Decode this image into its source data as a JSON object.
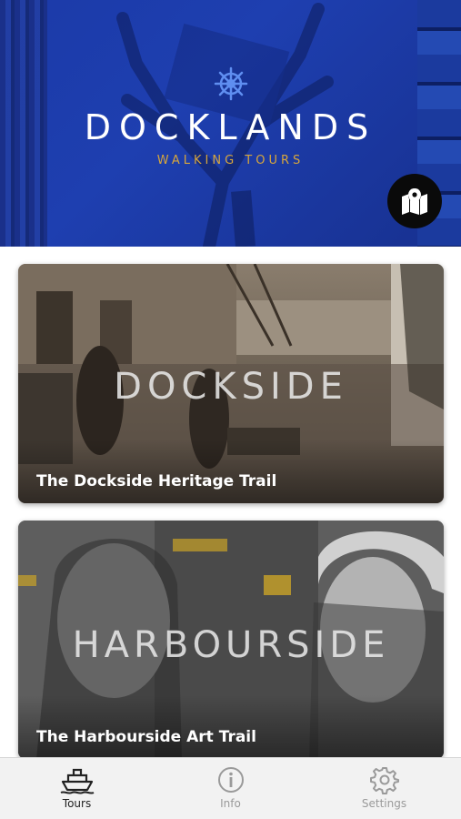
{
  "header": {
    "title": "DOCKLANDS",
    "subtitle": "WALKING TOURS",
    "wheel_icon": "ship-wheel-icon",
    "map_button_icon": "map-pin-icon",
    "colors": {
      "background": "#1e3fb0",
      "subtitle": "#d7a63c",
      "map_button": "#0a0a0a"
    }
  },
  "tours": [
    {
      "overlay_title": "DOCKSIDE",
      "name": "The Dockside Heritage Trail"
    },
    {
      "overlay_title": "HARBOURSIDE",
      "name": "The Harbourside Art Trail"
    }
  ],
  "tabbar": {
    "active": "Tours",
    "tabs": [
      {
        "label": "Tours",
        "icon": "ship-icon"
      },
      {
        "label": "Info",
        "icon": "info-icon"
      },
      {
        "label": "Settings",
        "icon": "gear-icon"
      }
    ]
  }
}
